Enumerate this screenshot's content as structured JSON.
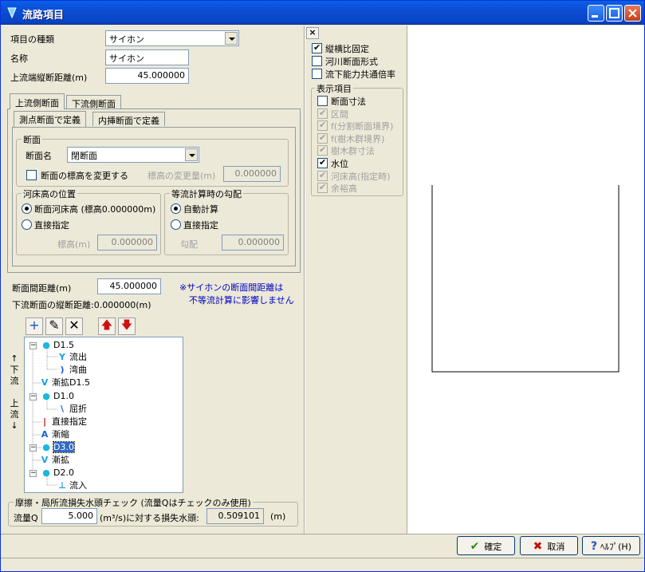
{
  "title": "流路項目",
  "left": {
    "kind_label": "項目の種類",
    "kind_value": "サイホン",
    "name_label": "名称",
    "name_value": "サイホン",
    "upstream_dist_label": "上流端縦断距離(m)",
    "upstream_dist_value": "45.000000",
    "tabs": [
      "上流側断面",
      "下流側断面"
    ],
    "subtabs": [
      "測点断面で定義",
      "内挿断面で定義"
    ],
    "section_group": "断面",
    "section_name_label": "断面名",
    "section_name_value": "閉断面",
    "change_elev_label": "断面の標高を変更する",
    "elev_change_label": "標高の変更量(m)",
    "elev_change_value": "0.000000",
    "bed_group": "河床高の位置",
    "bed_opt1": "断面河床高 (標高0.000000m)",
    "bed_opt2": "直接指定",
    "bed_elev_label": "標高(m)",
    "bed_elev_value": "0.000000",
    "slope_group": "等流計算時の勾配",
    "slope_opt1": "自動計算",
    "slope_opt2": "直接指定",
    "slope_label": "勾配",
    "slope_value": "0.000000",
    "interval_label": "断面間距離(m)",
    "interval_value": "45.000000",
    "downstream_label": "下流断面の縦断距離:0.000000(m)",
    "note1": "※サイホンの断面間距離は",
    "note2": "不等流計算に影響しません",
    "toolbar": {
      "add": "+",
      "edit": "✎",
      "delete": "✕",
      "up": "🡅",
      "down": "🡇"
    },
    "side_label": [
      "↑",
      "下",
      "流",
      "",
      "上",
      "流",
      "↓"
    ],
    "tree": [
      {
        "label": "D1.5",
        "icon": "node-icon",
        "level": 0
      },
      {
        "label": "流出",
        "icon": "outflow-icon",
        "level": 1
      },
      {
        "label": "湾曲",
        "icon": "bend-icon",
        "level": 1
      },
      {
        "label": "漸拡D1.5",
        "icon": "expand-icon",
        "level": 0
      },
      {
        "label": "D1.0",
        "icon": "node-icon",
        "level": 0
      },
      {
        "label": "屈折",
        "icon": "refraction-icon",
        "level": 1
      },
      {
        "label": "直接指定",
        "icon": "direct-icon",
        "level": 0
      },
      {
        "label": "漸縮",
        "icon": "contract-icon",
        "level": 0
      },
      {
        "label": "D3.0",
        "icon": "node-icon",
        "level": 0,
        "selected": true
      },
      {
        "label": "漸拡",
        "icon": "expand-icon",
        "level": 0
      },
      {
        "label": "D2.0",
        "icon": "node-icon",
        "level": 0
      },
      {
        "label": "流入",
        "icon": "inflow-icon",
        "level": 1
      }
    ],
    "loss_group": "摩擦・局所流損失水頭チェック (流量Qはチェックのみ使用)",
    "flow_label": "流量Q",
    "flow_value": "5.000",
    "flow_unit": "(m³/s)に対する損失水頭:",
    "loss_value": "0.509101",
    "loss_unit": "(m)"
  },
  "middle": {
    "close": "×",
    "chk_aspect": "縦横比固定",
    "chk_river": "河川断面形式",
    "chk_common": "流下能力共通倍率",
    "display_group": "表示項目",
    "items": [
      {
        "label": "断面寸法",
        "checked": false,
        "enabled": true
      },
      {
        "label": "区間",
        "checked": true,
        "enabled": false
      },
      {
        "label": "f(分割断面境界)",
        "checked": true,
        "enabled": false
      },
      {
        "label": "f(樹木群境界)",
        "checked": true,
        "enabled": false
      },
      {
        "label": "樹木群寸法",
        "checked": true,
        "enabled": false
      },
      {
        "label": "水位",
        "checked": true,
        "enabled": true
      },
      {
        "label": "河床高(指定時)",
        "checked": true,
        "enabled": false
      },
      {
        "label": "余裕高",
        "checked": true,
        "enabled": false
      }
    ]
  },
  "buttons": {
    "ok": "確定",
    "cancel": "取消",
    "help": "ﾍﾙﾌﾟ(H)"
  }
}
